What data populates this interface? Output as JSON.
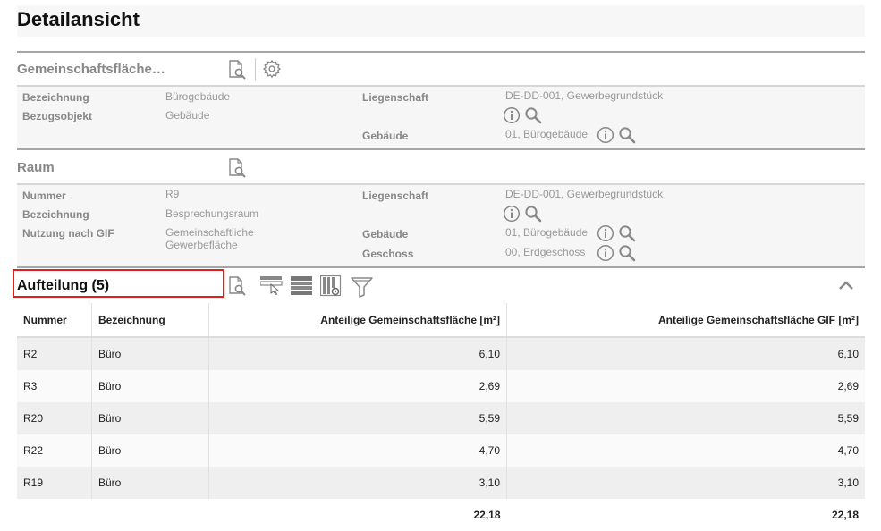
{
  "page": {
    "title": "Detailansicht"
  },
  "section1": {
    "title": "Gemeinschaftsfläche…",
    "icons": [
      "document-search-icon",
      "gear-icon"
    ],
    "left": [
      {
        "label": "Bezeichnung",
        "value": "Bürogebäude"
      },
      {
        "label": "Bezugsobjekt",
        "value": "Gebäude"
      }
    ],
    "right": [
      {
        "label": "Liegenschaft",
        "value": "DE-DD-001, Gewerbegrundstück"
      },
      {
        "label": "Gebäude",
        "value": "01, Bürogebäude"
      }
    ]
  },
  "section2": {
    "title": "Raum",
    "left": [
      {
        "label": "Nummer",
        "value": "R9"
      },
      {
        "label": "Bezeichnung",
        "value": "Besprechungsraum"
      },
      {
        "label": "Nutzung nach GIF",
        "value_line1": "Gemeinschaftliche",
        "value_line2": "Gewerbefläche"
      }
    ],
    "right": [
      {
        "label": "Liegenschaft",
        "value": "DE-DD-001, Gewerbegrundstück"
      },
      {
        "label": "Gebäude",
        "value": "01, Bürogebäude"
      },
      {
        "label": "Geschoss",
        "value": "00, Erdgeschoss"
      }
    ]
  },
  "section3": {
    "title": "Aufteilung (5)",
    "toolbar": [
      "document-search-icon",
      "filter-row-icon",
      "rows-icon",
      "columns-config-icon",
      "funnel-icon"
    ],
    "collapse_icon": "chevron-up-icon",
    "columns": [
      "Nummer",
      "Bezeichnung",
      "Anteilige Gemeinschaftsfläche [m²]",
      "Anteilige Gemeinschaftsfläche GIF [m²]"
    ],
    "rows": [
      [
        "R2",
        "Büro",
        "6,10",
        "6,10"
      ],
      [
        "R3",
        "Büro",
        "2,69",
        "2,69"
      ],
      [
        "R20",
        "Büro",
        "5,59",
        "5,59"
      ],
      [
        "R22",
        "Büro",
        "4,70",
        "4,70"
      ],
      [
        "R19",
        "Büro",
        "3,10",
        "3,10"
      ]
    ],
    "totals": [
      "",
      "",
      "22,18",
      "22,18"
    ]
  },
  "colors": {
    "accent_highlight": "#e02020",
    "icon": "#888888"
  }
}
